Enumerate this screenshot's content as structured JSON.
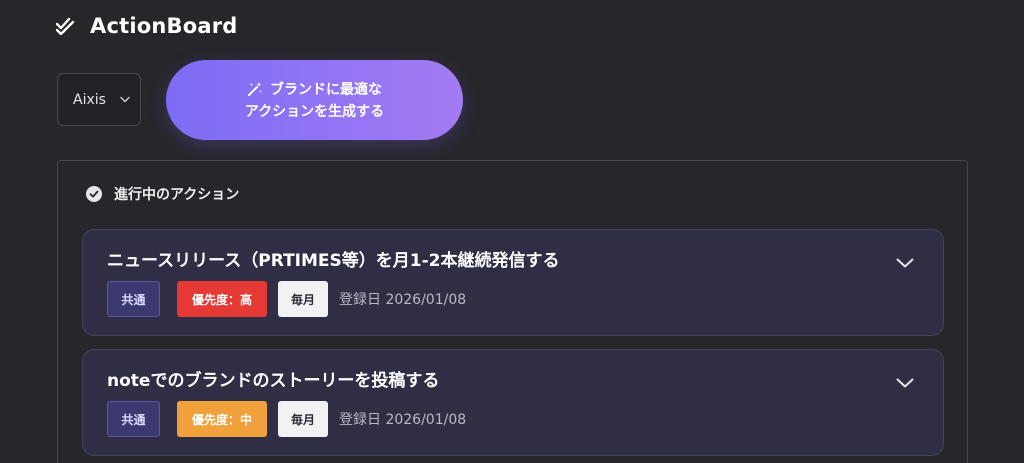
{
  "header": {
    "title": "ActionBoard",
    "logo_icon": "double-check-icon"
  },
  "controls": {
    "brand_select": {
      "value": "Aixis"
    },
    "generate_button": {
      "line1": "ブランドに最適な",
      "line2": "アクションを生成する",
      "icon": "magic-wand-icon"
    }
  },
  "section": {
    "title": "進行中のアクション",
    "icon": "check-circle-icon"
  },
  "actions": [
    {
      "title": "ニュースリリース（PRTIMES等）を月1-2本継続発信する",
      "scope": "共通",
      "priority": "優先度：高",
      "priority_color": "#e53935",
      "frequency": "毎月",
      "registered": "登録日 2026/01/08"
    },
    {
      "title": "noteでのブランドのストーリーを投稿する",
      "scope": "共通",
      "priority": "優先度：中",
      "priority_color": "#f0a13c",
      "frequency": "毎月",
      "registered": "登録日 2026/01/08"
    }
  ],
  "colors": {
    "background": "#27262b",
    "card": "#2f2e45",
    "accent_gradient_start": "#7c6cf5",
    "accent_gradient_end": "#a37bf3"
  }
}
